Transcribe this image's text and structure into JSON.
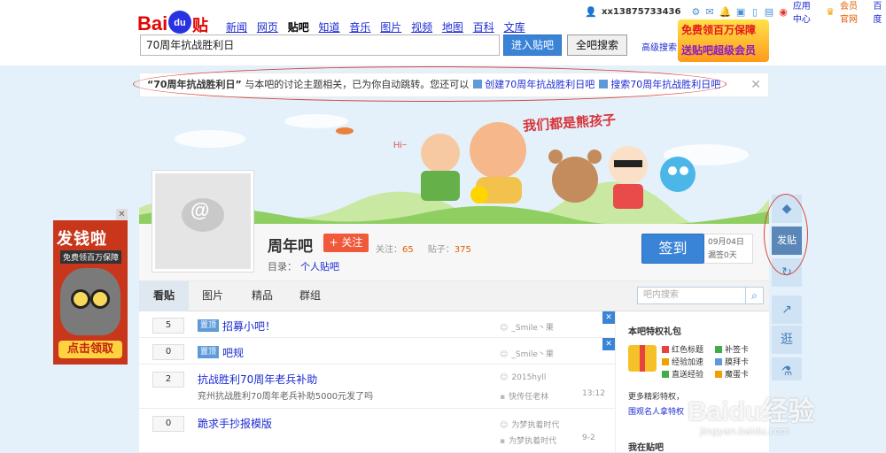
{
  "header": {
    "logo": {
      "bai": "Bai",
      "du": "du",
      "tieba": "贴吧"
    },
    "nav": [
      "新闻",
      "网页",
      "贴吧",
      "知道",
      "音乐",
      "图片",
      "视频",
      "地图",
      "百科",
      "文库"
    ],
    "nav_current": "贴吧",
    "search_value": "70周年抗战胜利日",
    "enter_btn": "进入贴吧",
    "all_search_btn": "全吧搜索",
    "adv_search": "高级搜索",
    "promo": {
      "line1": "免费领百万保障",
      "line2": "送贴吧超级会员"
    }
  },
  "userbar": {
    "username": "xx13875733436",
    "icons": [
      "user-icon",
      "gear-icon",
      "mail-icon",
      "bell-icon",
      "message-icon",
      "mobile-icon",
      "box-icon"
    ],
    "app_center": "应用中心",
    "vip": "会员官网",
    "home": "百度"
  },
  "notice": {
    "keyword": "“70周年抗战胜利日”",
    "text": " 与本吧的讨论主题相关，已为你自动跳转。您还可以",
    "create_link": "创建70周年抗战胜利日吧",
    "search_link": "搜索70周年抗战胜利日吧",
    "close": "✕"
  },
  "banner": {
    "slogan": "我们都是熊孩子",
    "hi": "Hi~"
  },
  "ad_left": {
    "title": "发钱啦",
    "sub": "免费领百万保障",
    "button": "点击领取",
    "close": "✕"
  },
  "forum": {
    "name": "周年吧",
    "follow_btn": "+ 关注",
    "follow_label": "关注：",
    "follow_count": "65",
    "posts_label": "贴子：",
    "posts_count": "375",
    "catalog_label": "目录：",
    "catalog_value": "个人贴吧",
    "signin_btn": "签到",
    "signin_date": "09月04日",
    "signin_missed": "漏签0天"
  },
  "tabs": [
    "看贴",
    "图片",
    "精品",
    "群组"
  ],
  "tab_current": "看贴",
  "inner_search_placeholder": "吧内搜索",
  "threads": [
    {
      "replies": "5",
      "tag": "置顶",
      "title": "招募小吧！",
      "author": "_Smile丶果",
      "abstract": "",
      "last": "",
      "time": ""
    },
    {
      "replies": "0",
      "tag": "置顶",
      "title": "吧规",
      "author": "_Smile丶果",
      "abstract": "",
      "last": "",
      "time": ""
    },
    {
      "replies": "2",
      "tag": "",
      "title": "抗战胜利70周年老兵补助",
      "author": "2015hyll",
      "abstract": "兖州抗战胜利70周年老兵补助5000元发了吗",
      "last": "快传任老林",
      "time": "13:12"
    },
    {
      "replies": "0",
      "tag": "",
      "title": "跪求手抄报模版",
      "author": "为梦执着时代",
      "abstract": "",
      "last": "为梦执着时代",
      "time": "9-2"
    }
  ],
  "right": {
    "gift_title": "本吧特权礼包",
    "gifts": [
      "红色标题",
      "补签卡",
      "经验加速",
      "膜拜卡",
      "直送经验",
      "魔蛋卡"
    ],
    "more": "更多精彩特权，",
    "celebrity": "围观名人拿特权",
    "in_forum": "我在贴吧"
  },
  "rtools": {
    "post": "发贴",
    "share": "↗",
    "top": "逛"
  },
  "watermark": {
    "main": "Baidu经验",
    "sub": "jingyan.baidu.com"
  },
  "colors": {
    "brand_blue": "#3a84d8",
    "link": "#1c2bd1",
    "follow": "#f1593b",
    "bg": "#e4f1fb",
    "annotation": "#d9463b"
  }
}
